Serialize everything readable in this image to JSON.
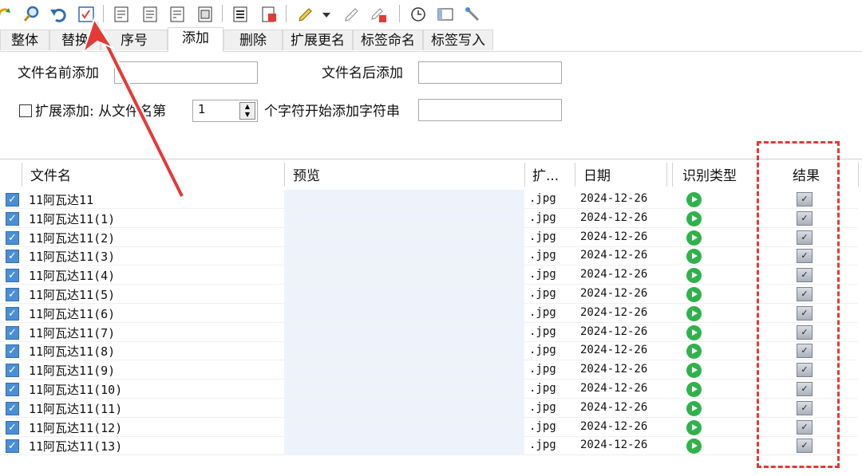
{
  "toolbar": {
    "icons": [
      "refresh-icon",
      "search-icon",
      "undo-icon",
      "check-icon",
      "doc-icon-1",
      "doc-icon-2",
      "doc-icon-3",
      "doc-icon-4",
      "list-icon",
      "export-icon",
      "edit-icon",
      "dropdown-icon",
      "edit-icon-2",
      "edit-delete-icon",
      "clock-icon",
      "window-icon",
      "tools-icon"
    ]
  },
  "tabs": [
    "整体",
    "替换",
    "序号",
    "添加",
    "删除",
    "扩展更名",
    "标签命名",
    "标签写入"
  ],
  "form": {
    "prefix_label": "文件名前添加",
    "suffix_label": "文件名后添加",
    "ext_add_label": "扩展添加: 从文件名第",
    "spin_value": "1",
    "after_spin_label": "个字符开始添加字符串"
  },
  "grid": {
    "headers": {
      "filename": "文件名",
      "preview": "预览",
      "ext": "扩...",
      "date": "日期",
      "type": "识别类型",
      "result": "结果"
    },
    "rows": [
      {
        "name": "11阿瓦达11",
        "ext": ".jpg",
        "date": "2024-12-26"
      },
      {
        "name": "11阿瓦达11(1)",
        "ext": ".jpg",
        "date": "2024-12-26"
      },
      {
        "name": "11阿瓦达11(2)",
        "ext": ".jpg",
        "date": "2024-12-26"
      },
      {
        "name": "11阿瓦达11(3)",
        "ext": ".jpg",
        "date": "2024-12-26"
      },
      {
        "name": "11阿瓦达11(4)",
        "ext": ".jpg",
        "date": "2024-12-26"
      },
      {
        "name": "11阿瓦达11(5)",
        "ext": ".jpg",
        "date": "2024-12-26"
      },
      {
        "name": "11阿瓦达11(6)",
        "ext": ".jpg",
        "date": "2024-12-26"
      },
      {
        "name": "11阿瓦达11(7)",
        "ext": ".jpg",
        "date": "2024-12-26"
      },
      {
        "name": "11阿瓦达11(8)",
        "ext": ".jpg",
        "date": "2024-12-26"
      },
      {
        "name": "11阿瓦达11(9)",
        "ext": ".jpg",
        "date": "2024-12-26"
      },
      {
        "name": "11阿瓦达11(10)",
        "ext": ".jpg",
        "date": "2024-12-26"
      },
      {
        "name": "11阿瓦达11(11)",
        "ext": ".jpg",
        "date": "2024-12-26"
      },
      {
        "name": "11阿瓦达11(12)",
        "ext": ".jpg",
        "date": "2024-12-26"
      },
      {
        "name": "11阿瓦达11(13)",
        "ext": ".jpg",
        "date": "2024-12-26"
      }
    ]
  },
  "colors": {
    "annotation_red": "#e53935",
    "checkbox_blue": "#4a8fd6",
    "status_green": "#2fb24a",
    "preview_bg": "#eef3fb"
  }
}
